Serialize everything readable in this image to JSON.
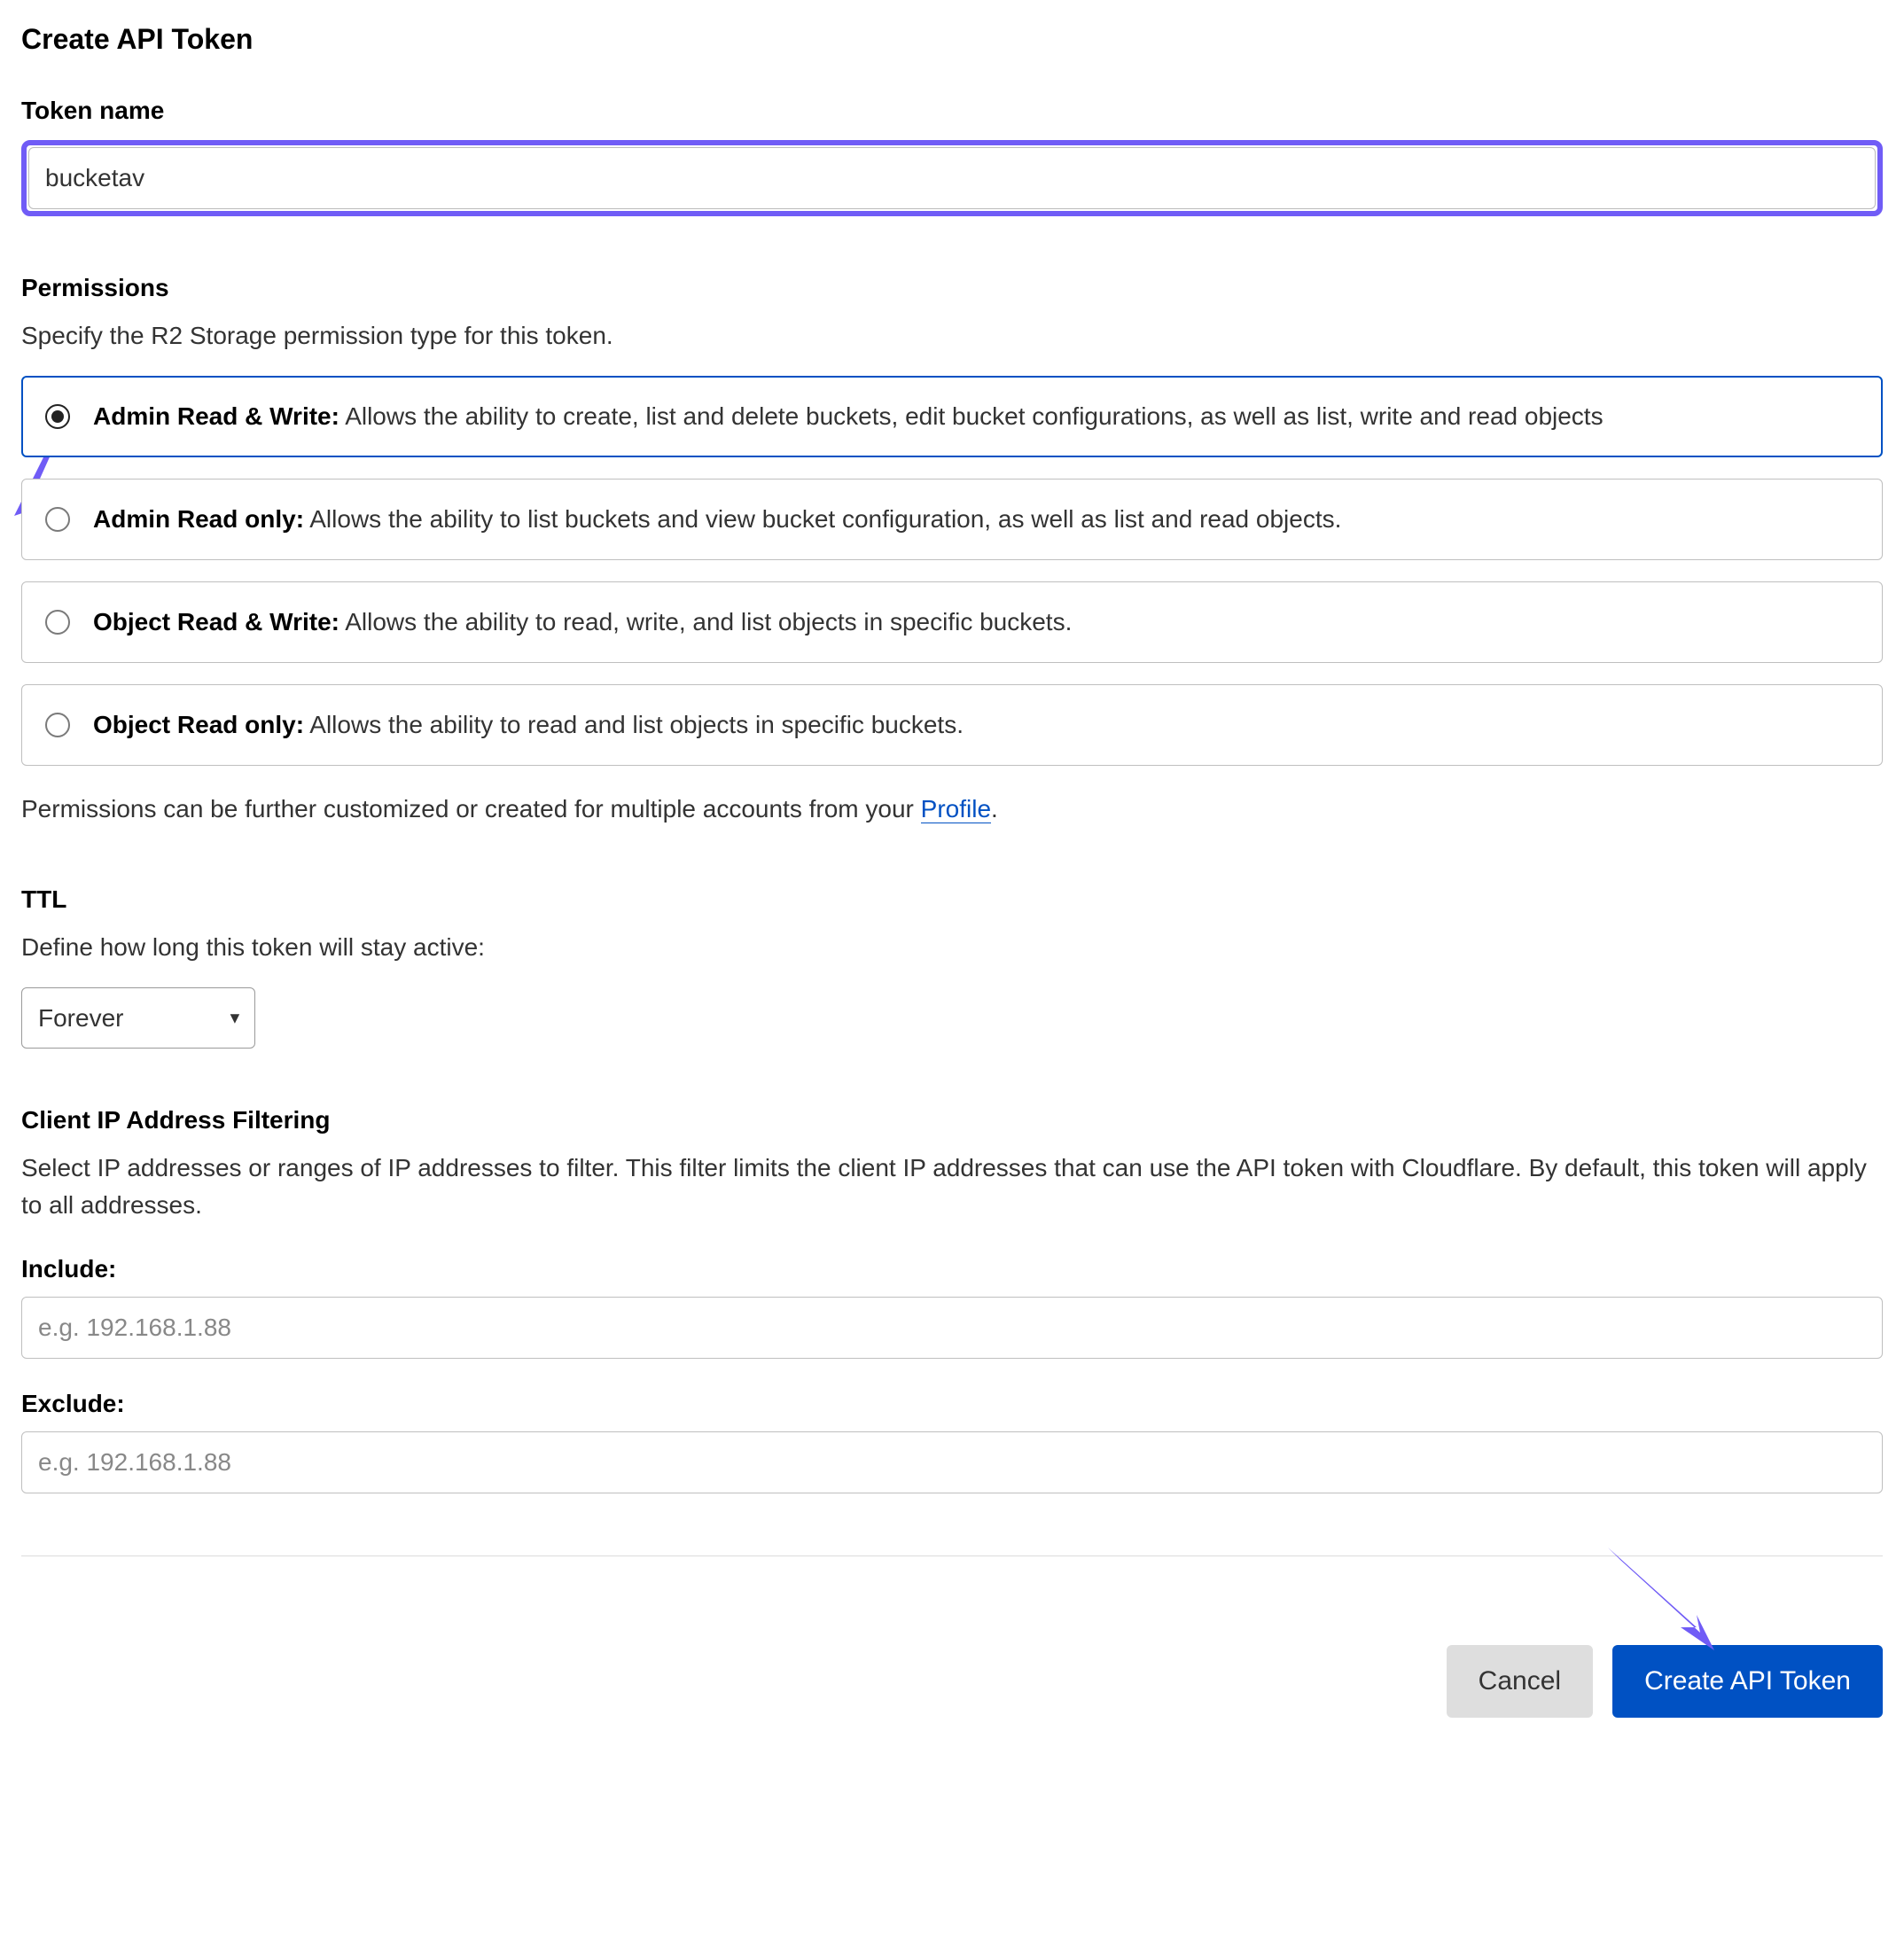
{
  "title": "Create API Token",
  "tokenName": {
    "label": "Token name",
    "value": "bucketav"
  },
  "permissions": {
    "label": "Permissions",
    "desc": "Specify the R2 Storage permission type for this token.",
    "options": [
      {
        "title": "Admin Read & Write:",
        "desc": " Allows the ability to create, list and delete buckets, edit bucket configurations, as well as list, write and read objects",
        "selected": true
      },
      {
        "title": "Admin Read only:",
        "desc": " Allows the ability to list buckets and view bucket configuration, as well as list and read objects.",
        "selected": false
      },
      {
        "title": "Object Read & Write:",
        "desc": " Allows the ability to read, write, and list objects in specific buckets.",
        "selected": false
      },
      {
        "title": "Object Read only:",
        "desc": " Allows the ability to read and list objects in specific buckets.",
        "selected": false
      }
    ],
    "noteBefore": "Permissions can be further customized or created for multiple accounts from your ",
    "noteLink": "Profile",
    "noteAfter": "."
  },
  "ttl": {
    "label": "TTL",
    "desc": "Define how long this token will stay active:",
    "value": "Forever"
  },
  "ipFilter": {
    "label": "Client IP Address Filtering",
    "desc": "Select IP addresses or ranges of IP addresses to filter. This filter limits the client IP addresses that can use the API token with Cloudflare. By default, this token will apply to all addresses.",
    "includeLabel": "Include:",
    "includePlaceholder": "e.g. 192.168.1.88",
    "excludeLabel": "Exclude:",
    "excludePlaceholder": "e.g. 192.168.1.88"
  },
  "footer": {
    "cancel": "Cancel",
    "create": "Create API Token"
  }
}
